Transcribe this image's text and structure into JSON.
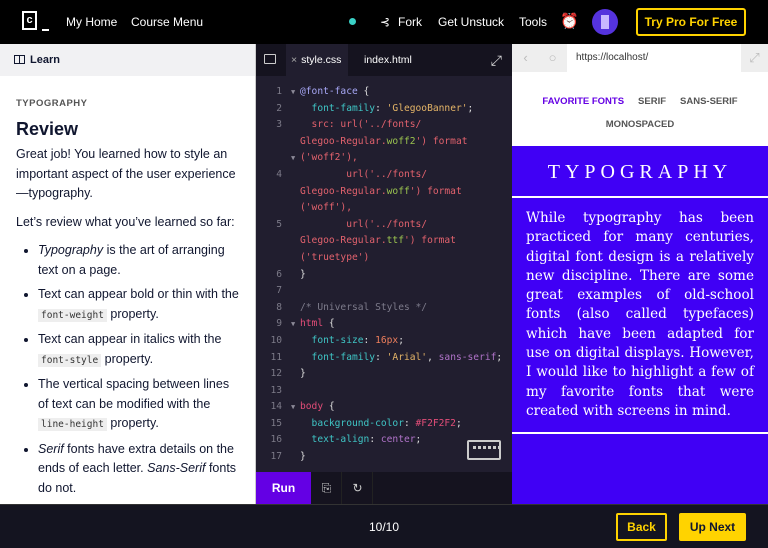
{
  "topbar": {
    "logo": "c",
    "my_home": "My Home",
    "course_menu": "Course Menu",
    "fork": "Fork",
    "get_unstuck": "Get Unstuck",
    "tools": "Tools",
    "try_pro": "Try Pro For Free"
  },
  "learn": {
    "header": "Learn",
    "kicker": "TYPOGRAPHY",
    "title": "Review",
    "intro": "Great job! You learned how to style an important aspect of the user experience—typography.",
    "lead": "Let’s review what you’ve learned so far:",
    "bullets": [
      {
        "em": "Typography",
        "text": " is the art of arranging text on a page."
      },
      {
        "text": "Text can appear bold or thin with the ",
        "code": "font-weight",
        "after": " property."
      },
      {
        "text": "Text can appear in italics with the ",
        "code": "font-style",
        "after": " property."
      },
      {
        "text": "The vertical spacing between lines of text can be modified with the ",
        "code": "line-height",
        "after": " property."
      },
      {
        "em": "Serif",
        "text": " fonts have extra details on the ends of each letter. ",
        "em2": "Sans-Serif",
        "after": " fonts do not."
      }
    ]
  },
  "editor": {
    "tabs": [
      "style.css",
      "index.html"
    ],
    "close": "×",
    "run": "Run",
    "rows": [
      {
        "n": "1",
        "f": true,
        "t": [
          [
            "@font-face",
            "at"
          ],
          [
            " {",
            "punc"
          ]
        ]
      },
      {
        "n": "2",
        "t": [
          [
            "  font-family",
            "prop"
          ],
          [
            ": ",
            "punc"
          ],
          [
            "'GlegooBanner'",
            "str"
          ],
          [
            ";",
            "punc"
          ]
        ]
      },
      {
        "n": "3",
        "t": [
          [
            "  src: url('../fonts/",
            "url"
          ]
        ]
      },
      {
        "n": "",
        "t": [
          [
            "Glegoo-Regular.",
            "url"
          ],
          [
            "woff2",
            "ext"
          ],
          [
            "') format",
            "url"
          ]
        ]
      },
      {
        "n": "",
        "f": true,
        "t": [
          [
            "('woff2'),",
            "url"
          ]
        ]
      },
      {
        "n": "4",
        "t": [
          [
            "        url('../fonts/",
            "url"
          ]
        ]
      },
      {
        "n": "",
        "t": [
          [
            "Glegoo-Regular.",
            "url"
          ],
          [
            "woff",
            "ext"
          ],
          [
            "') format",
            "url"
          ]
        ]
      },
      {
        "n": "",
        "t": [
          [
            "('woff'),",
            "url"
          ]
        ]
      },
      {
        "n": "5",
        "t": [
          [
            "        url('../fonts/",
            "url"
          ]
        ]
      },
      {
        "n": "",
        "t": [
          [
            "Glegoo-Regular.",
            "url"
          ],
          [
            "ttf",
            "ext"
          ],
          [
            "') format",
            "url"
          ]
        ]
      },
      {
        "n": "",
        "t": [
          [
            "('truetype')",
            "url"
          ]
        ]
      },
      {
        "n": "6",
        "t": [
          [
            "}",
            "punc"
          ]
        ]
      },
      {
        "n": "7",
        "t": []
      },
      {
        "n": "8",
        "t": [
          [
            "/* Universal Styles */",
            "com"
          ]
        ]
      },
      {
        "n": "9",
        "f": true,
        "t": [
          [
            "html",
            "sel"
          ],
          [
            " {",
            "punc"
          ]
        ]
      },
      {
        "n": "10",
        "t": [
          [
            "  font-size",
            "prop"
          ],
          [
            ": ",
            "punc"
          ],
          [
            "16px",
            "num"
          ],
          [
            ";",
            "punc"
          ]
        ]
      },
      {
        "n": "11",
        "t": [
          [
            "  font-family",
            "prop"
          ],
          [
            ": ",
            "punc"
          ],
          [
            "'Arial'",
            "str"
          ],
          [
            ", ",
            "punc"
          ],
          [
            "sans-serif",
            "kw"
          ],
          [
            ";",
            "punc"
          ]
        ]
      },
      {
        "n": "12",
        "t": [
          [
            "}",
            "punc"
          ]
        ]
      },
      {
        "n": "13",
        "t": []
      },
      {
        "n": "14",
        "f": true,
        "t": [
          [
            "body",
            "sel"
          ],
          [
            " {",
            "punc"
          ]
        ]
      },
      {
        "n": "15",
        "t": [
          [
            "  background-color",
            "prop"
          ],
          [
            ": ",
            "punc"
          ],
          [
            "#F2F2F2",
            "hex"
          ],
          [
            ";",
            "punc"
          ]
        ]
      },
      {
        "n": "16",
        "t": [
          [
            "  text-align",
            "prop"
          ],
          [
            ": ",
            "punc"
          ],
          [
            "center",
            "kw"
          ],
          [
            ";",
            "punc"
          ]
        ]
      },
      {
        "n": "17",
        "t": [
          [
            "}",
            "punc"
          ]
        ]
      }
    ]
  },
  "preview": {
    "url": "https://localhost/",
    "menu": [
      "FAVORITE FONTS",
      "SERIF",
      "SANS-SERIF",
      "MONOSPACED"
    ],
    "banner_title": "TYPOGRAPHY",
    "paragraph": "While typography has been practiced for many centuries, digital font design is a relatively new discipline. There are some great examples of old-school fonts (also called typefaces) which have been adapted for use on digital displays. However, I would like to highlight a few of my favorite fonts that were created with screens in mind."
  },
  "footer": {
    "progress": "10/10",
    "back": "Back",
    "next": "Up Next"
  },
  "colors": {
    "accent": "#6400E4",
    "pro": "#FFD300",
    "banner": "#4000F5"
  }
}
